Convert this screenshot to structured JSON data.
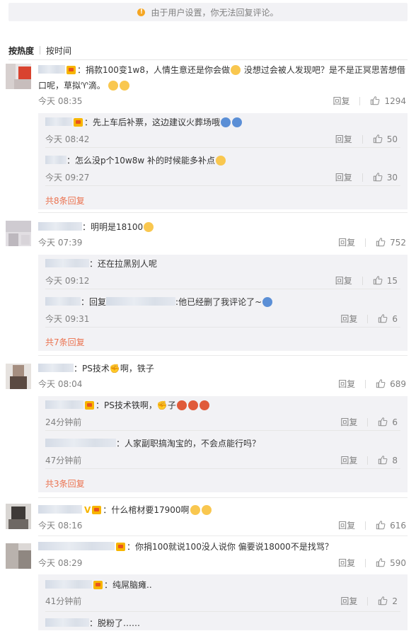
{
  "notice": {
    "text": "由于用户设置，你无法回复评论。"
  },
  "sort": {
    "hot": "按热度",
    "time": "按时间"
  },
  "labels": {
    "reply": "回复",
    "colon": "："
  },
  "comments": [
    {
      "text_a": "捐款100变1w8，人情生意还是你会做",
      "text_b": "没想过会被人发现吧？是不是正冥思苦想借",
      "text_c": "口呢，草拟",
      "text_d": "滴。",
      "time": "今天 08:35",
      "likes": "1294",
      "replies": [
        {
          "text": "先上车后补票，这边建议火葬场哦",
          "time": "今天 08:42",
          "likes": "50"
        },
        {
          "text": "怎么没p个10w8w 补的时候能多补点",
          "time": "今天 09:27",
          "likes": "30"
        }
      ],
      "more": "共8条回复"
    },
    {
      "text": "明明是18100",
      "time": "今天 07:39",
      "likes": "752",
      "replies": [
        {
          "text": "还在拉黑别人呢",
          "time": "今天 09:12",
          "likes": "15"
        },
        {
          "prefix": "回复",
          "text": ":他已经删了我评论了~",
          "time": "今天 09:31",
          "likes": "6"
        }
      ],
      "more": "共7条回复"
    },
    {
      "text": "PS技术",
      "text_b": "啊，铁子",
      "time": "今天 08:04",
      "likes": "689",
      "replies": [
        {
          "text": "PS技术铁啊，",
          "text_b": "子",
          "time": "24分钟前",
          "likes": "6"
        },
        {
          "text": "人家副职搞淘宝的，不会点能行吗？",
          "time": "47分钟前",
          "likes": "8"
        }
      ],
      "more": "共3条回复"
    },
    {
      "badge": "V",
      "text": "什么棺材要17900啊",
      "time": "今天 08:16",
      "likes": "616"
    },
    {
      "text": "你捐100就说100没人说你 偏要说18000不是找骂？",
      "time": "今天 08:29",
      "likes": "590",
      "replies": [
        {
          "text": "纯屌脑瘫..",
          "time": "41分钟前",
          "likes": "2"
        },
        {
          "text": "脱粉了……"
        }
      ]
    }
  ]
}
